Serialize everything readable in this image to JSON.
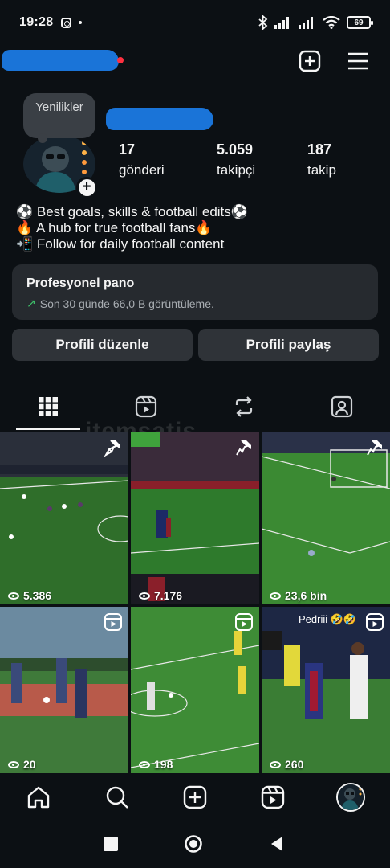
{
  "status_bar": {
    "time": "19:28",
    "battery": "69"
  },
  "profile": {
    "note": "Yenilikler",
    "posts_count": "17",
    "posts_label": "gönderi",
    "followers_count": "5.059",
    "followers_label": "takipçi",
    "following_count": "187",
    "following_label": "takip",
    "bio": [
      "⚽ Best goals, skills & football edits⚽",
      "🔥 A hub for true football fans🔥",
      "📲 Follow for daily football content"
    ]
  },
  "dashboard": {
    "title": "Profesyonel pano",
    "subtitle": "Son 30 günde 66,0 B görüntüleme."
  },
  "buttons": {
    "edit_profile": "Profili düzenle",
    "share_profile": "Profili paylaş"
  },
  "tabs": [
    "posts-grid-icon",
    "reels-icon",
    "reposts-icon",
    "tagged-icon"
  ],
  "watermark": "itemsatis",
  "grid": [
    {
      "views": "5.386",
      "badge": "pin-icon"
    },
    {
      "views": "7.176",
      "badge": "pin-icon"
    },
    {
      "views": "23,6 bin",
      "badge": "pin-icon"
    },
    {
      "views": "20",
      "badge": "reel-icon"
    },
    {
      "views": "198",
      "badge": "reel-icon"
    },
    {
      "views": "260",
      "badge": "reel-icon",
      "caption": "Pedriii 🤣🤣"
    }
  ],
  "bottom_nav": [
    "home-icon",
    "search-icon",
    "create-icon",
    "reels-icon",
    "profile-avatar"
  ],
  "colors": {
    "background": "#0c1014",
    "card": "#262a2f",
    "button": "#2f3338",
    "redaction": "#1a74d8",
    "notification": "#ff3040",
    "trend_up": "#3ec26b"
  }
}
